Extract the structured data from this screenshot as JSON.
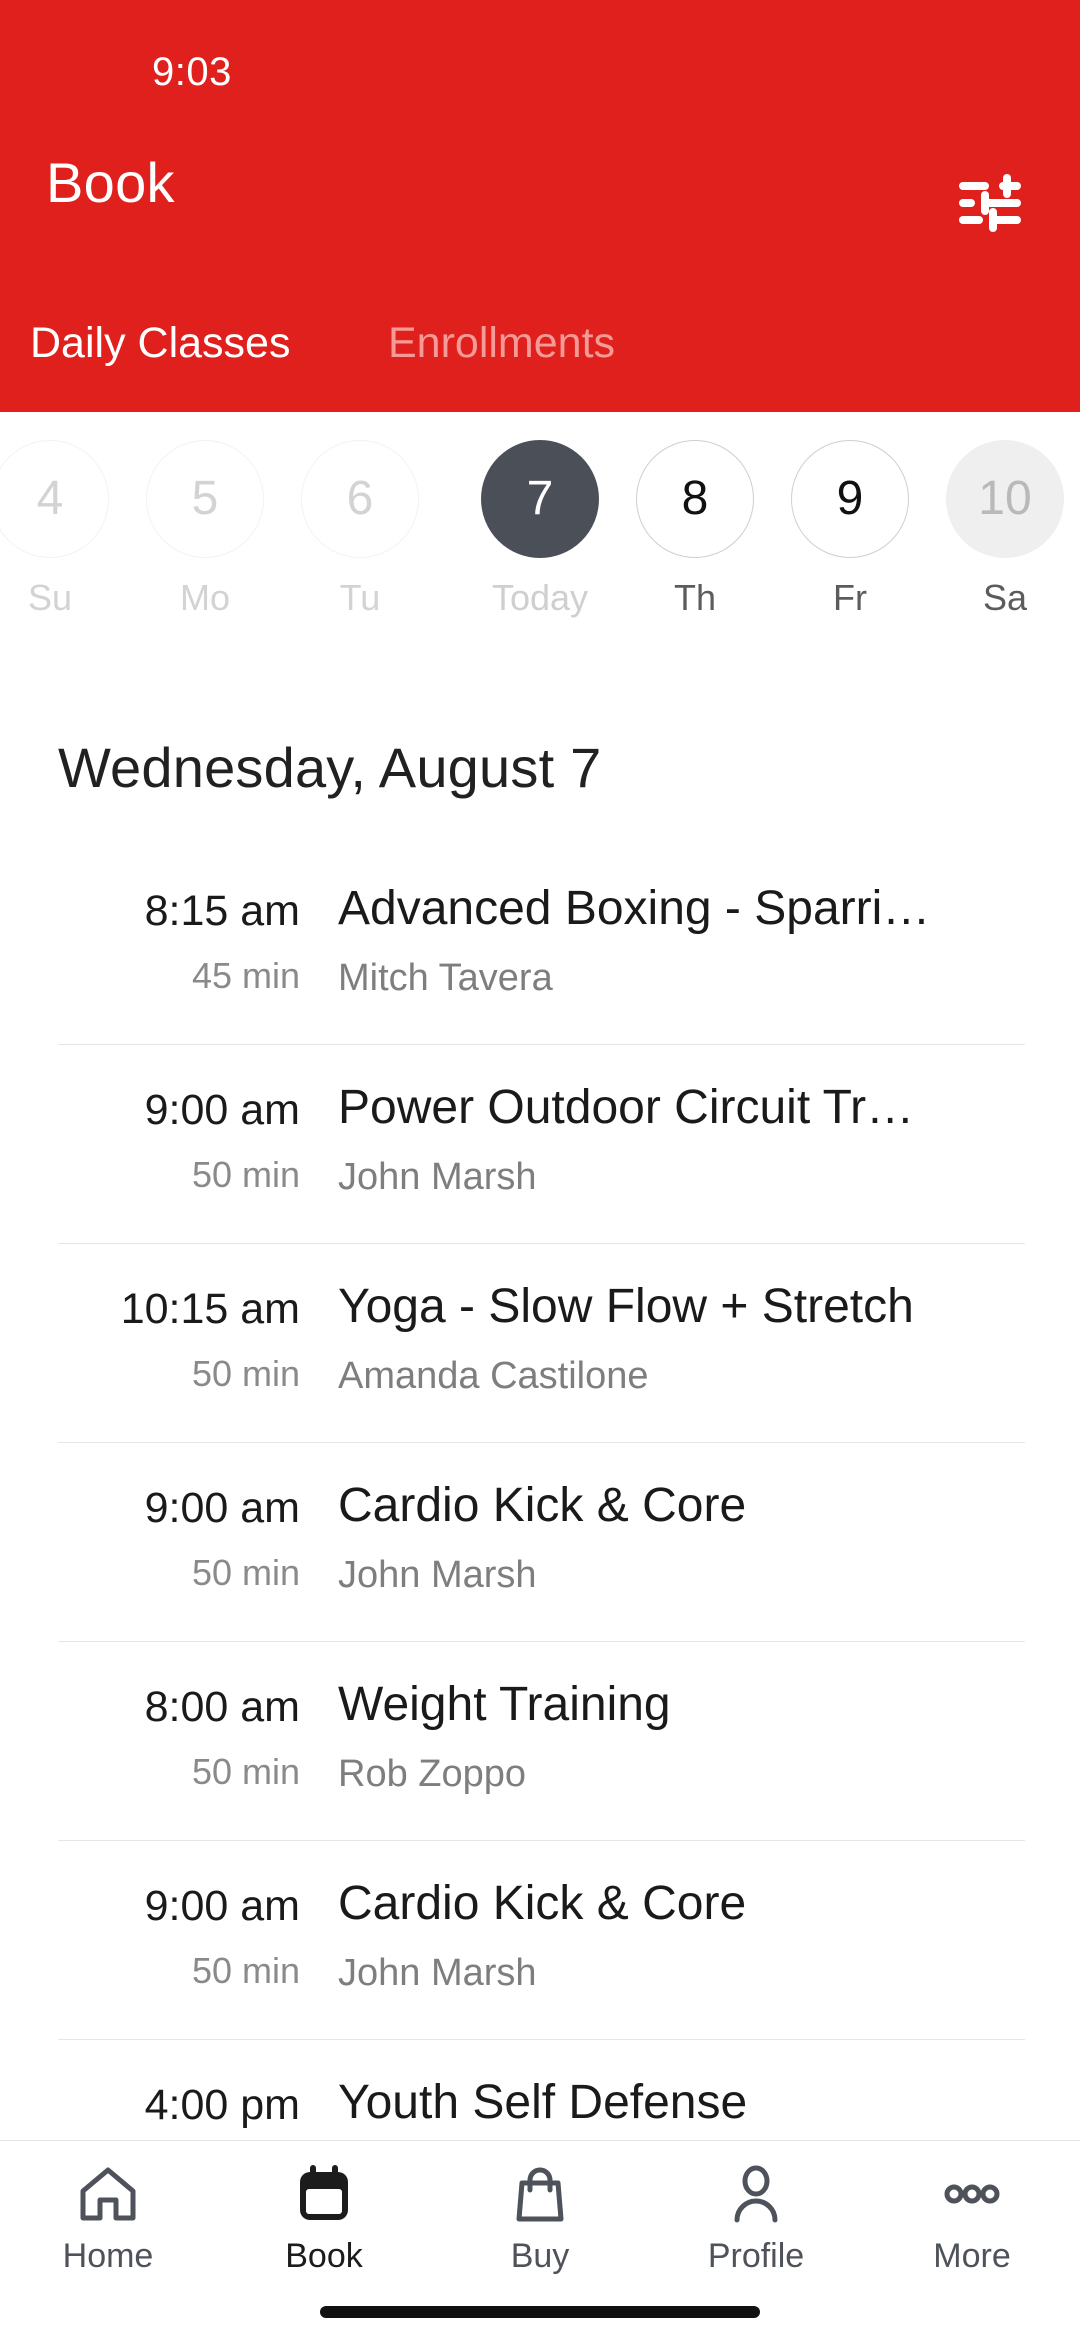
{
  "status_bar": {
    "time": "9:03"
  },
  "header": {
    "title": "Book",
    "filter_icon": "tune-filter-icon",
    "background_color": "#E0201C",
    "tabs": [
      {
        "label": "Daily Classes",
        "active": true
      },
      {
        "label": "Enrollments",
        "active": false
      }
    ]
  },
  "date_strip": {
    "days": [
      {
        "number": "4",
        "weekday": "Su",
        "state": "disabled"
      },
      {
        "number": "5",
        "weekday": "Mo",
        "state": "disabled"
      },
      {
        "number": "6",
        "weekday": "Tu",
        "state": "disabled"
      },
      {
        "number": "7",
        "weekday": "Today",
        "state": "selected"
      },
      {
        "number": "8",
        "weekday": "Th",
        "state": "enabled"
      },
      {
        "number": "9",
        "weekday": "Fr",
        "state": "enabled"
      },
      {
        "number": "10",
        "weekday": "Sa",
        "state": "future"
      }
    ],
    "selected_color": "#4B4F58"
  },
  "day_heading": "Wednesday, August 7",
  "classes": [
    {
      "time": "8:15 am",
      "duration": "45 min",
      "title": "Advanced Boxing - Sparri…",
      "instructor": "Mitch Tavera"
    },
    {
      "time": "9:00 am",
      "duration": "50 min",
      "title": "Power Outdoor Circuit Tr…",
      "instructor": "John Marsh"
    },
    {
      "time": "10:15 am",
      "duration": "50 min",
      "title": "Yoga - Slow Flow + Stretch",
      "instructor": "Amanda Castilone"
    },
    {
      "time": "9:00 am",
      "duration": "50 min",
      "title": "Cardio Kick & Core",
      "instructor": "John Marsh"
    },
    {
      "time": "8:00 am",
      "duration": "50 min",
      "title": "Weight Training",
      "instructor": "Rob Zoppo"
    },
    {
      "time": "9:00 am",
      "duration": "50 min",
      "title": "Cardio Kick & Core",
      "instructor": "John Marsh"
    },
    {
      "time": "4:00 pm",
      "duration": "",
      "title": "Youth Self Defense",
      "instructor": ""
    }
  ],
  "bottom_nav": {
    "items": [
      {
        "label": "Home",
        "icon": "home-icon",
        "active": false
      },
      {
        "label": "Book",
        "icon": "calendar-icon",
        "active": true
      },
      {
        "label": "Buy",
        "icon": "bag-icon",
        "active": false
      },
      {
        "label": "Profile",
        "icon": "person-icon",
        "active": false
      },
      {
        "label": "More",
        "icon": "ellipsis-icon",
        "active": false
      }
    ]
  }
}
